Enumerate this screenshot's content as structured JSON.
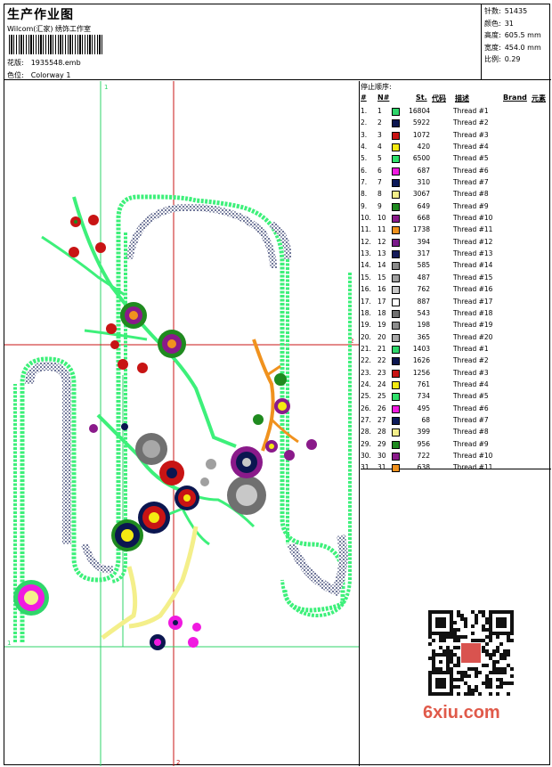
{
  "header": {
    "title": "生产作业图",
    "company": "Wilcom(汇家) 绣饰工作室",
    "design_label": "花版:",
    "design_value": "1935548.emb",
    "color_label": "色位:",
    "color_value": "Colorway 1"
  },
  "stats": [
    {
      "label": "针数:",
      "value": "51435"
    },
    {
      "label": "颜色:",
      "value": "31"
    },
    {
      "label": "高度:",
      "value": "605.5 mm"
    },
    {
      "label": "宽度:",
      "value": "454.0 mm"
    },
    {
      "label": "比例:",
      "value": "0.29"
    }
  ],
  "canvas": {
    "marker_top": "1",
    "marker_left": "1",
    "marker_bottom": "2",
    "marker_right": "2"
  },
  "sequence": {
    "title": "停止顺序:",
    "headers": {
      "num": "#",
      "n": "N#",
      "st": "St.",
      "code": "代码",
      "desc": "描述",
      "brand": "Brand",
      "elem": "元素"
    },
    "rows": [
      {
        "num": "1.",
        "n": "1",
        "color": "#2fd66a",
        "st": "16804",
        "desc": "Thread #1"
      },
      {
        "num": "2.",
        "n": "2",
        "color": "#0b1650",
        "st": "5922",
        "desc": "Thread #2"
      },
      {
        "num": "3.",
        "n": "3",
        "color": "#c81414",
        "st": "1072",
        "desc": "Thread #3"
      },
      {
        "num": "4.",
        "n": "4",
        "color": "#f4ea12",
        "st": "420",
        "desc": "Thread #4"
      },
      {
        "num": "5.",
        "n": "5",
        "color": "#2fe06a",
        "st": "6500",
        "desc": "Thread #5"
      },
      {
        "num": "6.",
        "n": "6",
        "color": "#f01ae0",
        "st": "687",
        "desc": "Thread #6"
      },
      {
        "num": "7.",
        "n": "7",
        "color": "#0c1a5a",
        "st": "310",
        "desc": "Thread #7"
      },
      {
        "num": "8.",
        "n": "8",
        "color": "#f4ef8a",
        "st": "3067",
        "desc": "Thread #8"
      },
      {
        "num": "9.",
        "n": "9",
        "color": "#1f8a1f",
        "st": "649",
        "desc": "Thread #9"
      },
      {
        "num": "10.",
        "n": "10",
        "color": "#8a1a8a",
        "st": "668",
        "desc": "Thread #10"
      },
      {
        "num": "11.",
        "n": "11",
        "color": "#f0921e",
        "st": "1738",
        "desc": "Thread #11"
      },
      {
        "num": "12.",
        "n": "12",
        "color": "#7a1a8a",
        "st": "394",
        "desc": "Thread #12"
      },
      {
        "num": "13.",
        "n": "13",
        "color": "#141a5a",
        "st": "317",
        "desc": "Thread #13"
      },
      {
        "num": "14.",
        "n": "14",
        "color": "#8a8a8a",
        "st": "585",
        "desc": "Thread #14"
      },
      {
        "num": "15.",
        "n": "15",
        "color": "#a0a0a0",
        "st": "487",
        "desc": "Thread #15"
      },
      {
        "num": "16.",
        "n": "16",
        "color": "#c8c8c8",
        "st": "762",
        "desc": "Thread #16"
      },
      {
        "num": "17.",
        "n": "17",
        "color": "#ffffff",
        "st": "887",
        "desc": "Thread #17"
      },
      {
        "num": "18.",
        "n": "18",
        "color": "#707070",
        "st": "543",
        "desc": "Thread #18"
      },
      {
        "num": "19.",
        "n": "19",
        "color": "#8c8c8c",
        "st": "198",
        "desc": "Thread #19"
      },
      {
        "num": "20.",
        "n": "20",
        "color": "#a8a8a8",
        "st": "365",
        "desc": "Thread #20"
      },
      {
        "num": "21.",
        "n": "21",
        "color": "#2fd66a",
        "st": "1403",
        "desc": "Thread #1"
      },
      {
        "num": "22.",
        "n": "22",
        "color": "#0b1650",
        "st": "1626",
        "desc": "Thread #2"
      },
      {
        "num": "23.",
        "n": "23",
        "color": "#c81414",
        "st": "1256",
        "desc": "Thread #3"
      },
      {
        "num": "24.",
        "n": "24",
        "color": "#f4ea12",
        "st": "761",
        "desc": "Thread #4"
      },
      {
        "num": "25.",
        "n": "25",
        "color": "#2fe06a",
        "st": "734",
        "desc": "Thread #5"
      },
      {
        "num": "26.",
        "n": "26",
        "color": "#f01ae0",
        "st": "495",
        "desc": "Thread #6"
      },
      {
        "num": "27.",
        "n": "27",
        "color": "#0c1a5a",
        "st": "68",
        "desc": "Thread #7"
      },
      {
        "num": "28.",
        "n": "28",
        "color": "#f4ef8a",
        "st": "399",
        "desc": "Thread #8"
      },
      {
        "num": "29.",
        "n": "29",
        "color": "#1f8a1f",
        "st": "956",
        "desc": "Thread #9"
      },
      {
        "num": "30.",
        "n": "30",
        "color": "#8a1a8a",
        "st": "722",
        "desc": "Thread #10"
      },
      {
        "num": "31.",
        "n": "31",
        "color": "#f0921e",
        "st": "638",
        "desc": "Thread #11"
      }
    ]
  },
  "watermark": {
    "site": "6xiu.com"
  },
  "colors": {
    "guide_green": "#2fd66a",
    "guide_red": "#c81414",
    "satin_green": "#3df07a",
    "navy": "#0b1650"
  }
}
